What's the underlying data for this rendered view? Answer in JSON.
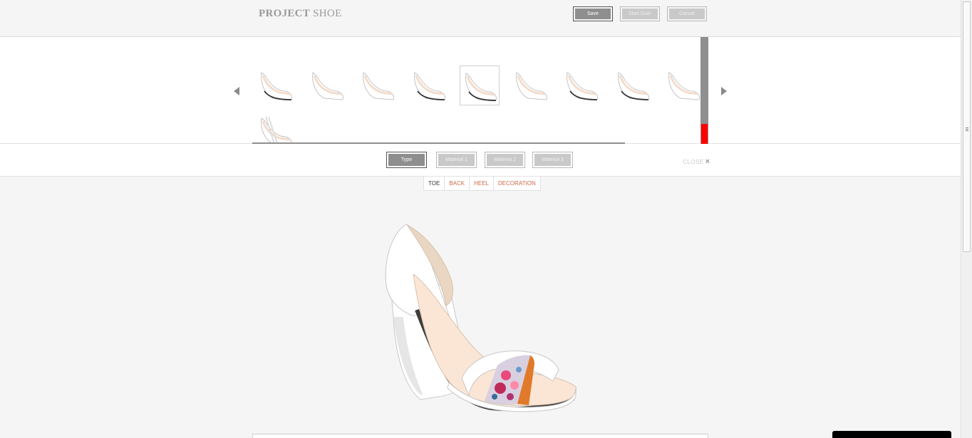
{
  "header": {
    "logo_bold": "PROJECT",
    "logo_rest": " SHOE",
    "buttons": [
      {
        "label": "Save",
        "active": true
      },
      {
        "label": "Start Over",
        "active": false
      },
      {
        "label": "Cancel",
        "active": false
      }
    ]
  },
  "picker": {
    "selected_index": 4,
    "thumb_count": 10
  },
  "tabs": [
    {
      "label": "Type",
      "active": true
    },
    {
      "label": "Material 1",
      "active": false
    },
    {
      "label": "Material 2",
      "active": false
    },
    {
      "label": "Material 3",
      "active": false
    }
  ],
  "close_label": "CLOSE",
  "parts": [
    {
      "label": "TOE",
      "active": true
    },
    {
      "label": "BACK",
      "active": false
    },
    {
      "label": "HEEL",
      "active": false
    },
    {
      "label": "DECORATION",
      "active": false
    }
  ],
  "colors": {
    "accent_red": "#ff0000",
    "part_link": "#d06a4a",
    "strap_orange": "#e07a2a",
    "lining_peach": "#fbe6d6"
  }
}
